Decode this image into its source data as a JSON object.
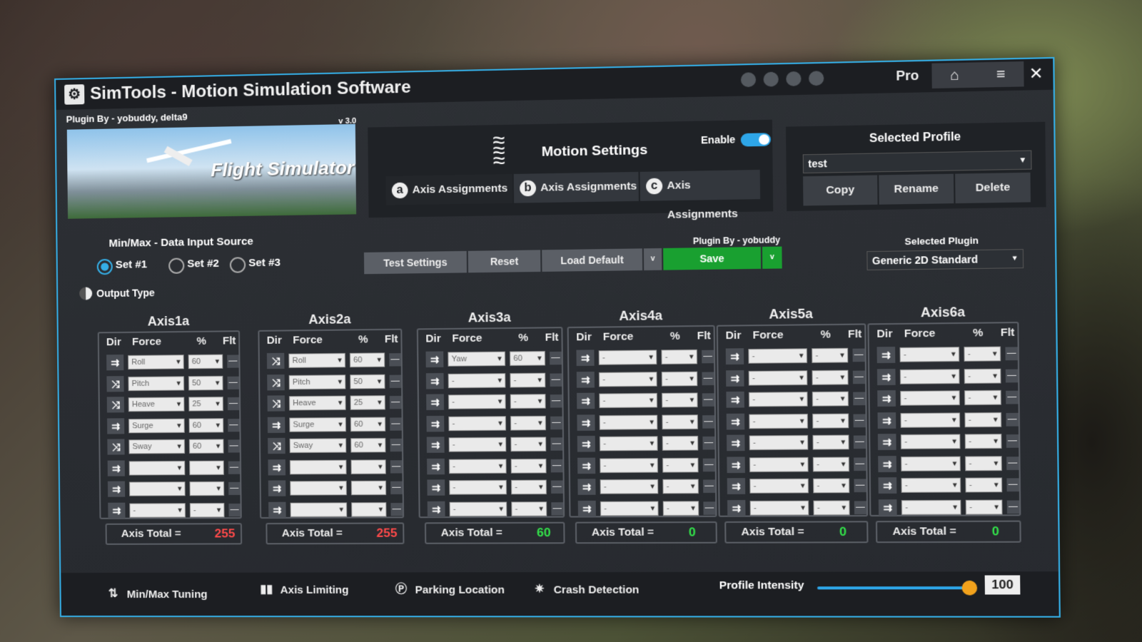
{
  "window": {
    "title": "SimTools - Motion Simulation Software",
    "logo": "SimTools logo",
    "pro_label": "Pro"
  },
  "banner": {
    "plugin_by": "Plugin By - yobuddy, delta9",
    "version": "v 3.0",
    "game_name": "Flight Simulator"
  },
  "motion": {
    "title": "Motion Settings",
    "enable_label": "Enable",
    "enabled": true,
    "tabs": [
      {
        "letter": "a",
        "label": "Axis Assignments",
        "active": true
      },
      {
        "letter": "b",
        "label": "Axis Assignments",
        "active": false
      },
      {
        "letter": "c",
        "label": "Axis Assignments",
        "active": false
      }
    ]
  },
  "profile": {
    "title": "Selected Profile",
    "value": "test",
    "copy": "Copy",
    "rename": "Rename",
    "delete": "Delete"
  },
  "input_source": {
    "label": "Min/Max - Data Input Source",
    "sets": [
      "Set #1",
      "Set #2",
      "Set #3"
    ],
    "selected": "Set #1"
  },
  "output_type_label": "Output Type",
  "actions": {
    "test": "Test Settings",
    "reset": "Reset",
    "load_default": "Load Default",
    "save": "Save",
    "dropdown": "v",
    "plugin_by": "Plugin By - yobuddy"
  },
  "plugin": {
    "label": "Selected Plugin",
    "value": "Generic 2D Standard"
  },
  "axis_headers": {
    "dir": "Dir",
    "force": "Force",
    "pct": "%",
    "flt": "Flt"
  },
  "axis_total_label": "Axis Total =",
  "axes": [
    {
      "name": "Axis1a",
      "total": "255",
      "rows": [
        {
          "force": "Roll",
          "pct": "60"
        },
        {
          "force": "Pitch",
          "pct": "50"
        },
        {
          "force": "Heave",
          "pct": "25"
        },
        {
          "force": "Surge",
          "pct": "60"
        },
        {
          "force": "Sway",
          "pct": "60"
        },
        {
          "force": "",
          "pct": ""
        },
        {
          "force": "",
          "pct": ""
        },
        {
          "force": "-",
          "pct": "-"
        }
      ]
    },
    {
      "name": "Axis2a",
      "total": "255",
      "rows": [
        {
          "force": "Roll",
          "pct": "60"
        },
        {
          "force": "Pitch",
          "pct": "50"
        },
        {
          "force": "Heave",
          "pct": "25"
        },
        {
          "force": "Surge",
          "pct": "60"
        },
        {
          "force": "Sway",
          "pct": "60"
        },
        {
          "force": "",
          "pct": ""
        },
        {
          "force": "",
          "pct": ""
        },
        {
          "force": "",
          "pct": ""
        }
      ]
    },
    {
      "name": "Axis3a",
      "total": "60",
      "rows": [
        {
          "force": "Yaw",
          "pct": "60"
        },
        {
          "force": "-",
          "pct": "-"
        },
        {
          "force": "-",
          "pct": "-"
        },
        {
          "force": "-",
          "pct": "-"
        },
        {
          "force": "-",
          "pct": "-"
        },
        {
          "force": "-",
          "pct": "-"
        },
        {
          "force": "-",
          "pct": "-"
        },
        {
          "force": "-",
          "pct": "-"
        }
      ]
    },
    {
      "name": "Axis4a",
      "total": "0",
      "rows": [
        {
          "force": "-",
          "pct": "-"
        },
        {
          "force": "-",
          "pct": "-"
        },
        {
          "force": "-",
          "pct": "-"
        },
        {
          "force": "-",
          "pct": "-"
        },
        {
          "force": "-",
          "pct": "-"
        },
        {
          "force": "-",
          "pct": "-"
        },
        {
          "force": "-",
          "pct": "-"
        },
        {
          "force": "-",
          "pct": "-"
        }
      ]
    },
    {
      "name": "Axis5a",
      "total": "0",
      "rows": [
        {
          "force": "-",
          "pct": "-"
        },
        {
          "force": "-",
          "pct": "-"
        },
        {
          "force": "-",
          "pct": "-"
        },
        {
          "force": "-",
          "pct": "-"
        },
        {
          "force": "-",
          "pct": "-"
        },
        {
          "force": "-",
          "pct": "-"
        },
        {
          "force": "-",
          "pct": "-"
        },
        {
          "force": "-",
          "pct": "-"
        }
      ]
    },
    {
      "name": "Axis6a",
      "total": "0",
      "rows": [
        {
          "force": "-",
          "pct": "-"
        },
        {
          "force": "-",
          "pct": "-"
        },
        {
          "force": "-",
          "pct": "-"
        },
        {
          "force": "-",
          "pct": "-"
        },
        {
          "force": "-",
          "pct": "-"
        },
        {
          "force": "-",
          "pct": "-"
        },
        {
          "force": "-",
          "pct": "-"
        },
        {
          "force": "-",
          "pct": "-"
        }
      ]
    }
  ],
  "bottom": {
    "minmax": "Min/Max Tuning",
    "limiting": "Axis Limiting",
    "parking": "Parking Location",
    "crash": "Crash Detection",
    "intensity_label": "Profile Intensity",
    "intensity_value": "100"
  },
  "colors": {
    "accent": "#35aee6",
    "save": "#19a030",
    "total_nonzero": "#ff4a4a",
    "total_ok": "#33e04a"
  }
}
